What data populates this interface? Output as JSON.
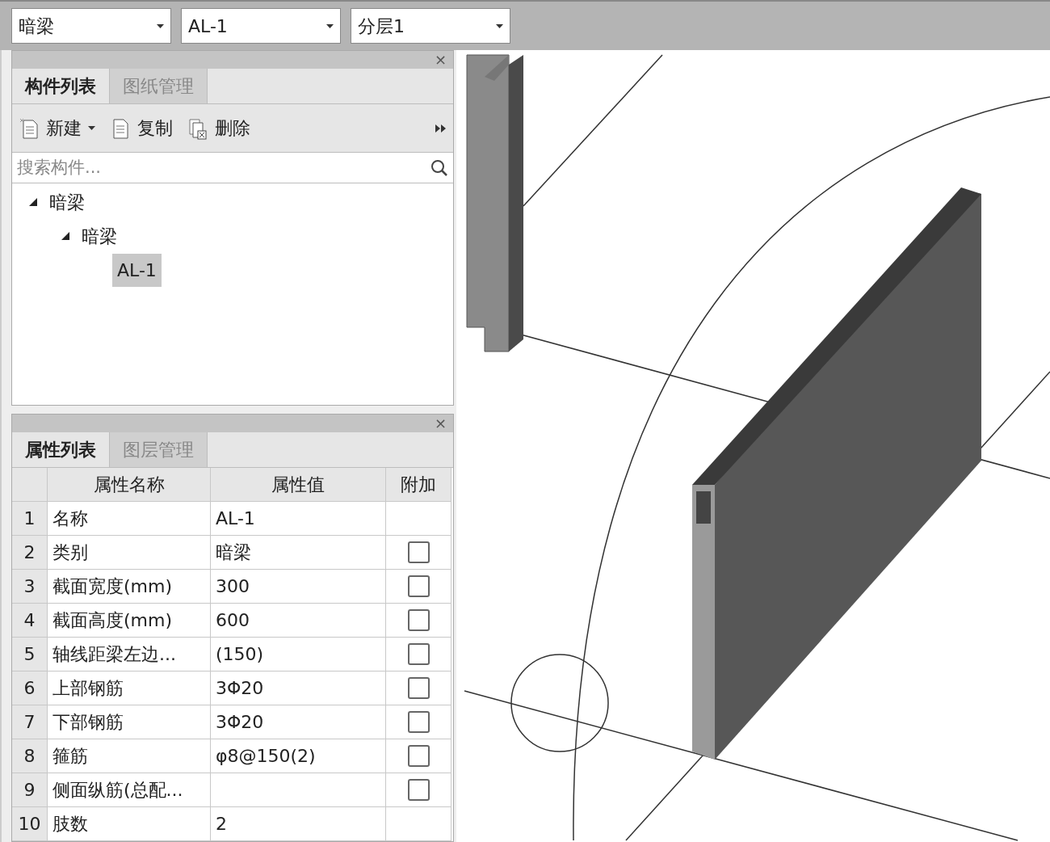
{
  "toolbar": {
    "dropdowns": [
      {
        "value": "暗梁"
      },
      {
        "value": "AL-1"
      },
      {
        "value": "分层1"
      }
    ]
  },
  "component_panel": {
    "close": "×",
    "tabs": [
      {
        "label": "构件列表",
        "selected": true
      },
      {
        "label": "图纸管理",
        "selected": false
      }
    ],
    "actions": [
      {
        "label": "新建",
        "kind": "new",
        "dropdown": true
      },
      {
        "label": "复制",
        "kind": "copy",
        "dropdown": false
      },
      {
        "label": "删除",
        "kind": "delete",
        "dropdown": false
      }
    ],
    "search": {
      "placeholder": "搜索构件..."
    },
    "tree": [
      {
        "label": "暗梁",
        "expanded": true,
        "selected": false,
        "children": [
          {
            "label": "暗梁",
            "expanded": true,
            "selected": false,
            "children": [
              {
                "label": "AL-1",
                "selected": true
              }
            ]
          }
        ]
      }
    ]
  },
  "property_panel": {
    "close": "×",
    "tabs": [
      {
        "label": "属性列表",
        "selected": true
      },
      {
        "label": "图层管理",
        "selected": false
      }
    ],
    "columns": [
      "属性名称",
      "属性值",
      "附加"
    ],
    "rows": [
      {
        "index": "1",
        "name": "名称",
        "value": "AL-1"
      },
      {
        "index": "2",
        "name": "类别",
        "value": "暗梁",
        "checked": false
      },
      {
        "index": "3",
        "name": "截面宽度(mm)",
        "value": "300",
        "checked": false
      },
      {
        "index": "4",
        "name": "截面高度(mm)",
        "value": "600",
        "checked": false
      },
      {
        "index": "5",
        "name": "轴线距梁左边...",
        "value": "(150)",
        "checked": false
      },
      {
        "index": "6",
        "name": "上部钢筋",
        "value": "3Φ20",
        "checked": false
      },
      {
        "index": "7",
        "name": "下部钢筋",
        "value": "3Φ20",
        "checked": false
      },
      {
        "index": "8",
        "name": "箍筋",
        "value": "φ8@150(2)",
        "checked": false
      },
      {
        "index": "9",
        "name": "侧面纵筋(总配...",
        "value": "",
        "checked": false
      },
      {
        "index": "10",
        "name": "肢数",
        "value": "2"
      }
    ]
  }
}
